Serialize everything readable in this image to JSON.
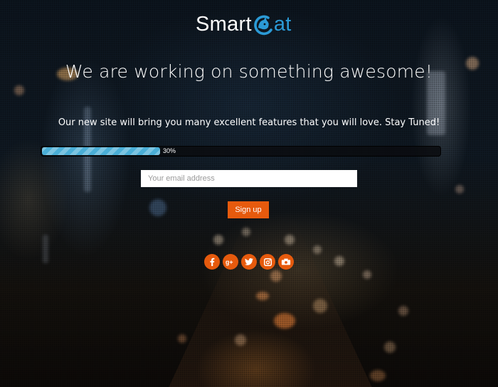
{
  "logo": {
    "part_a": "Smart",
    "part_b": "at",
    "icon": "c-cat-icon",
    "accent": "#2b9ad6"
  },
  "headline": "We are working on something awesome!",
  "subline": "Our new site will bring you many excellent features that you will love. Stay Tuned!",
  "progress": {
    "value": 0.3,
    "label": "30%"
  },
  "signup": {
    "placeholder": "Your email address",
    "button_label": "Sign up"
  },
  "social": [
    {
      "name": "facebook-icon",
      "glyph": "f"
    },
    {
      "name": "google-plus-icon",
      "glyph": "g+"
    },
    {
      "name": "twitter-icon",
      "glyph": ""
    },
    {
      "name": "instagram-icon",
      "glyph": ""
    },
    {
      "name": "foursquare-icon",
      "glyph": ""
    }
  ],
  "colors": {
    "accent": "#e65a0d",
    "progress": "#4aaed6"
  }
}
